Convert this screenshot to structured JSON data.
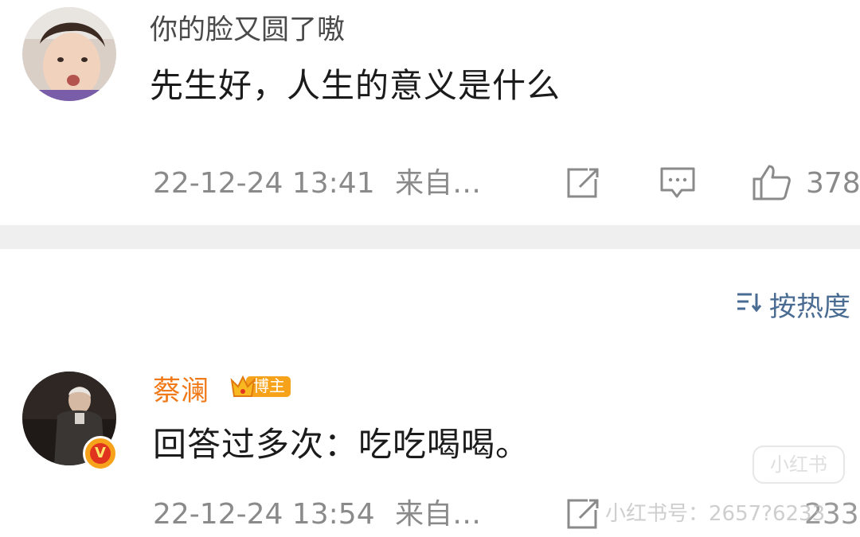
{
  "comments": [
    {
      "username": "你的脸又圆了嗷",
      "text": "先生好，人生的意义是什么",
      "time": "22-12-24 13:41",
      "source": "来自…",
      "likes": "378"
    },
    {
      "username": "蔡澜",
      "badge_label": "博主",
      "text": "回答过多次：吃吃喝喝。",
      "time": "22-12-24 13:54",
      "source": "来自…",
      "likes_partial": "233"
    }
  ],
  "sort": {
    "label": "按热度"
  },
  "watermark": {
    "text": "小红书号：2657?6233",
    "logo": "小红书"
  },
  "colors": {
    "username_vip": "#f07a1a",
    "sort_link": "#4a6c93",
    "meta_gray": "#8a8a8a",
    "divider": "#efefef"
  },
  "icons": {
    "repost": "share-square-icon",
    "comment": "comment-bubble-icon",
    "like": "thumbs-up-icon",
    "sort": "sort-lines-icon",
    "verified": "verified-v-icon"
  }
}
